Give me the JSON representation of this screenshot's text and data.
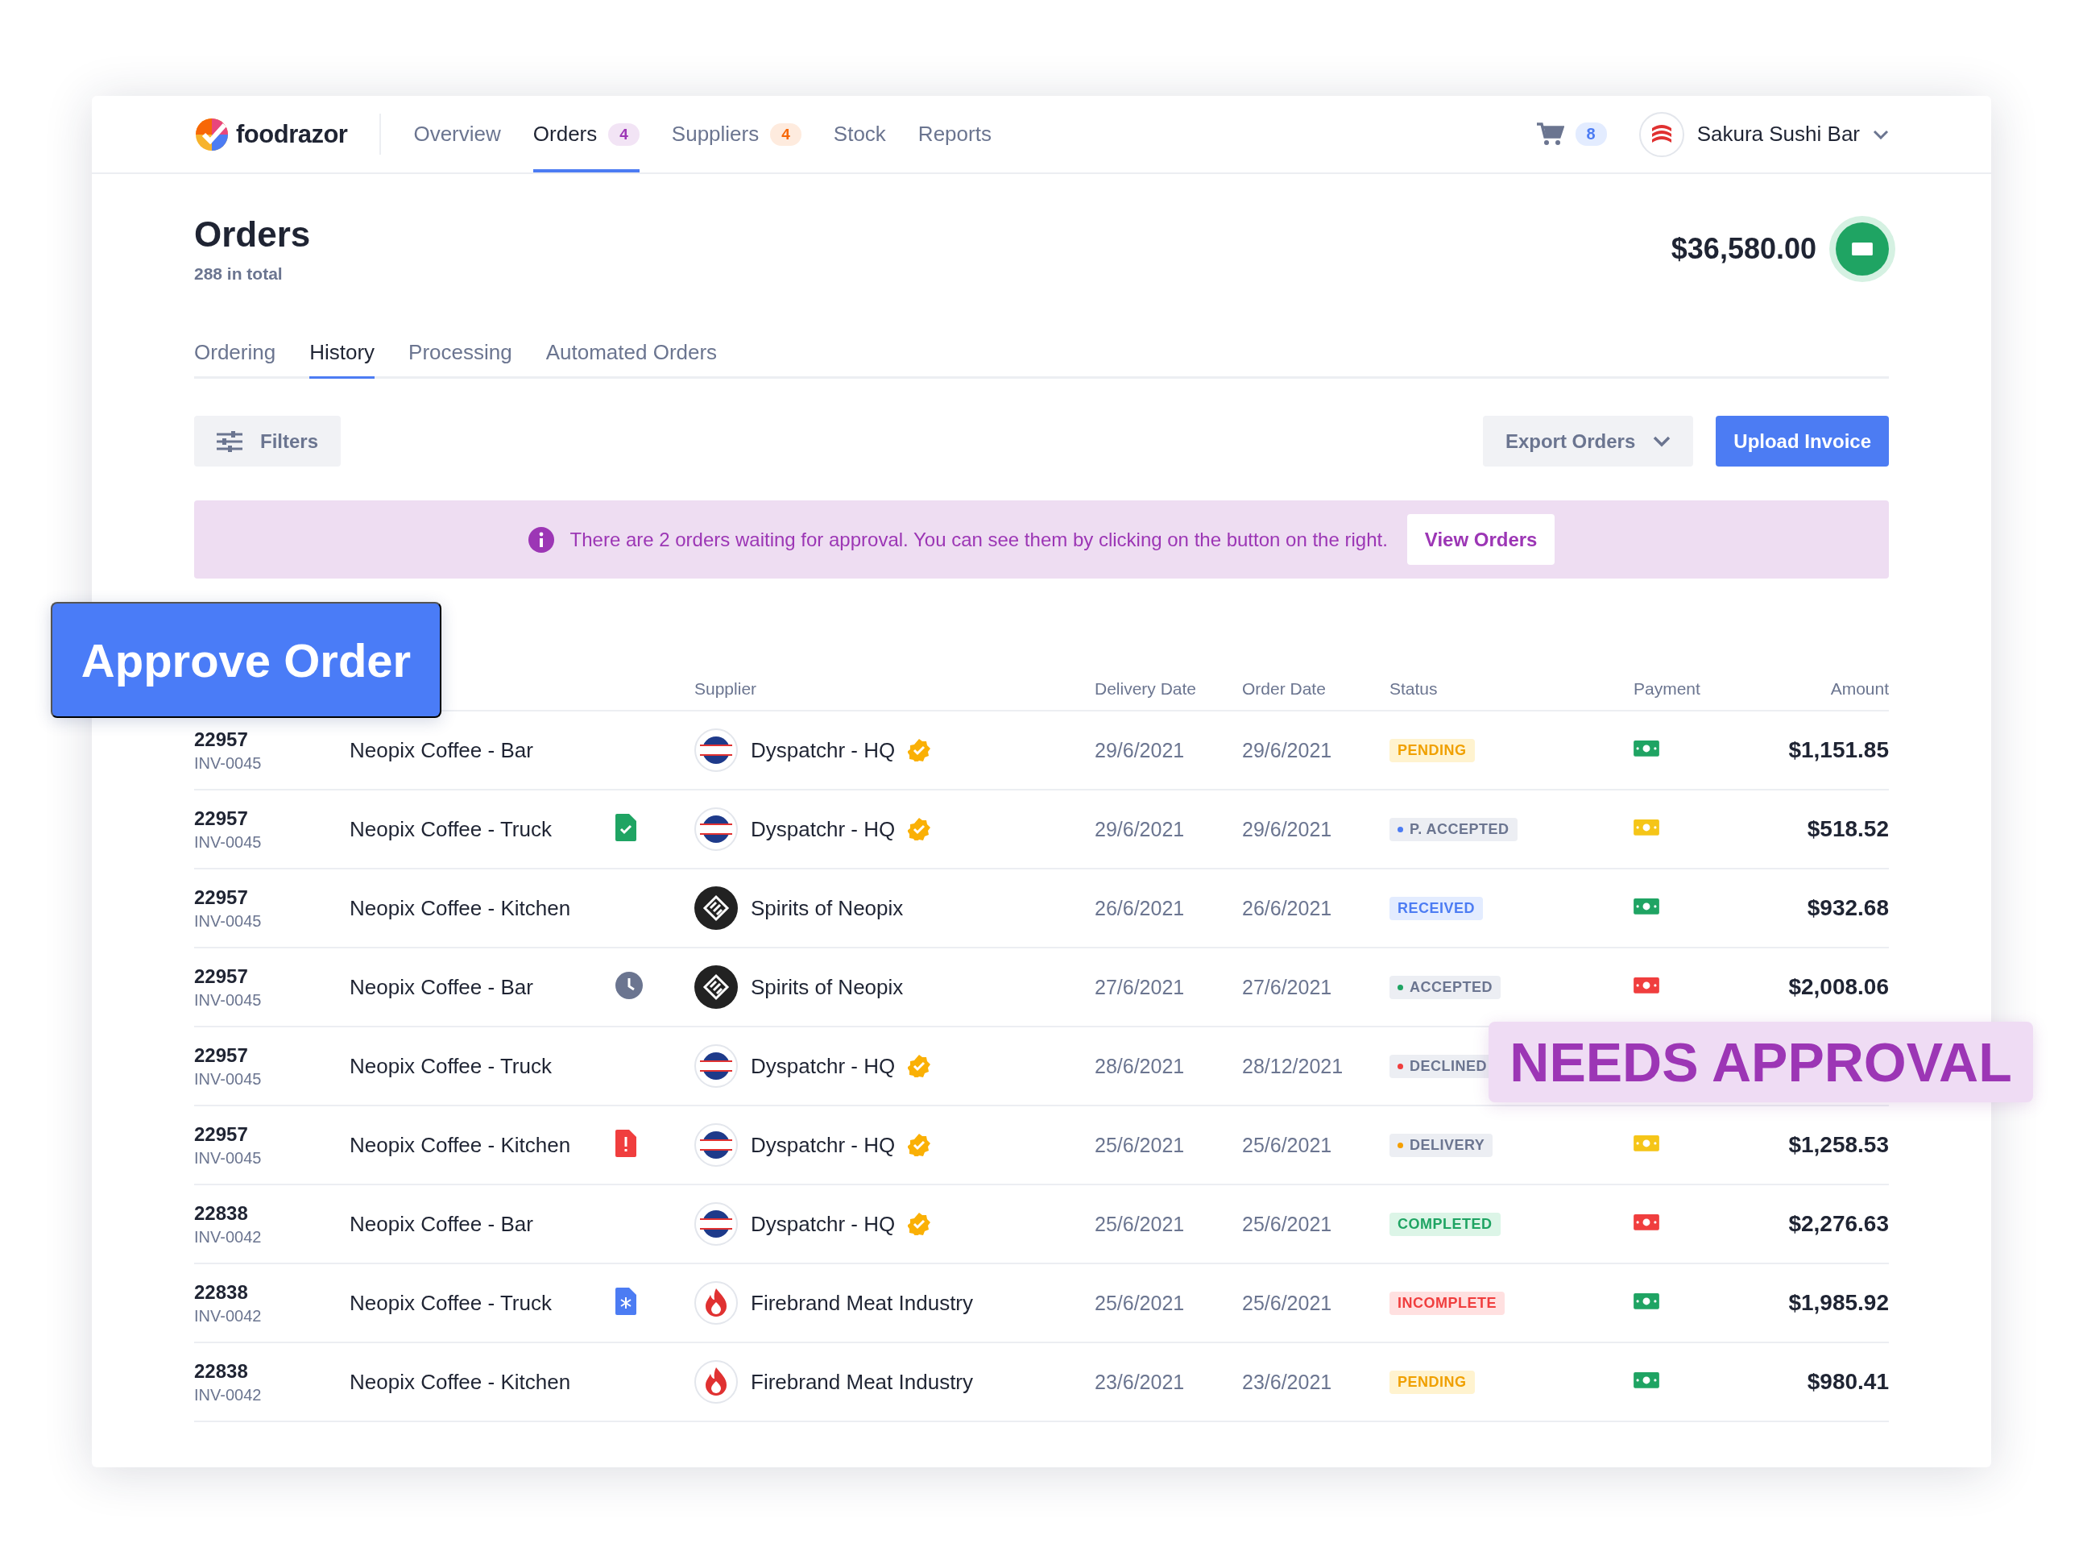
{
  "brand": {
    "name": "foodrazor"
  },
  "nav": [
    {
      "label": "Overview",
      "selected": false
    },
    {
      "label": "Orders",
      "badge": "4",
      "color": "#9c36b5",
      "selected": true
    },
    {
      "label": "Suppliers",
      "badge": "4",
      "color": "#f76707",
      "selected": false
    },
    {
      "label": "Stock",
      "selected": false
    },
    {
      "label": "Reports",
      "selected": false
    }
  ],
  "cart": {
    "count": "8"
  },
  "account": {
    "name": "Sakura Sushi Bar"
  },
  "page": {
    "title": "Orders",
    "subtitle": "288 in total",
    "total": "$36,580.00"
  },
  "tabs": [
    {
      "label": "Ordering",
      "selected": false
    },
    {
      "label": "History",
      "selected": true
    },
    {
      "label": "Processing",
      "selected": false
    },
    {
      "label": "Automated Orders",
      "selected": false
    }
  ],
  "toolbar": {
    "filters": "Filters",
    "export": "Export Orders",
    "upload": "Upload Invoice"
  },
  "banner": {
    "text": "There are 2 orders waiting for approval. You can see them by clicking on the button on the right.",
    "button": "View Orders"
  },
  "table": {
    "columns": [
      "Supplier",
      "Delivery Date",
      "Order Date",
      "Status",
      "Payment",
      "Amount"
    ],
    "rows": [
      {
        "id": "22957",
        "invoice": "INV-0045",
        "location": "Neopix Coffee - Bar",
        "supplier": {
          "name": "Dyspatchr - HQ",
          "kind": "dyspatchr",
          "verified": true
        },
        "delivery": "29/6/2021",
        "ordered": "29/6/2021",
        "status": {
          "label": "PENDING",
          "kind": "pending"
        },
        "payment": {
          "color": "#1fa463"
        },
        "amount": "$1,151.85"
      },
      {
        "id": "22957",
        "invoice": "INV-0045",
        "location": "Neopix Coffee - Truck",
        "flag": {
          "kind": "check-doc"
        },
        "supplier": {
          "name": "Dyspatchr - HQ",
          "kind": "dyspatchr",
          "verified": true
        },
        "delivery": "29/6/2021",
        "ordered": "29/6/2021",
        "status": {
          "label": "P. ACCEPTED",
          "kind": "dot-blue"
        },
        "payment": {
          "color": "#f5c518"
        },
        "amount": "$518.52"
      },
      {
        "id": "22957",
        "invoice": "INV-0045",
        "location": "Neopix Coffee - Kitchen",
        "supplier": {
          "name": "Spirits of Neopix",
          "kind": "spirits",
          "verified": false
        },
        "delivery": "26/6/2021",
        "ordered": "26/6/2021",
        "status": {
          "label": "RECEIVED",
          "kind": "received"
        },
        "payment": {
          "color": "#1fa463"
        },
        "amount": "$932.68"
      },
      {
        "id": "22957",
        "invoice": "INV-0045",
        "location": "Neopix Coffee - Bar",
        "flag": {
          "kind": "clock"
        },
        "supplier": {
          "name": "Spirits of Neopix",
          "kind": "spirits",
          "verified": false
        },
        "delivery": "27/6/2021",
        "ordered": "27/6/2021",
        "status": {
          "label": "ACCEPTED",
          "kind": "dot-green"
        },
        "payment": {
          "color": "#f03e3e"
        },
        "amount": "$2,008.06"
      },
      {
        "id": "22957",
        "invoice": "INV-0045",
        "location": "Neopix Coffee - Truck",
        "supplier": {
          "name": "Dyspatchr - HQ",
          "kind": "dyspatchr",
          "verified": true
        },
        "delivery": "28/6/2021",
        "ordered": "28/12/2021",
        "status": {
          "label": "DECLINED",
          "kind": "dot-red"
        }
      },
      {
        "id": "22957",
        "invoice": "INV-0045",
        "location": "Neopix Coffee - Kitchen",
        "flag": {
          "kind": "alert-doc"
        },
        "supplier": {
          "name": "Dyspatchr - HQ",
          "kind": "dyspatchr",
          "verified": true
        },
        "delivery": "25/6/2021",
        "ordered": "25/6/2021",
        "status": {
          "label": "DELIVERY",
          "kind": "dot-orange"
        },
        "payment": {
          "color": "#f5c518"
        },
        "amount": "$1,258.53"
      },
      {
        "id": "22838",
        "invoice": "INV-0042",
        "location": "Neopix Coffee - Bar",
        "supplier": {
          "name": "Dyspatchr - HQ",
          "kind": "dyspatchr",
          "verified": true
        },
        "delivery": "25/6/2021",
        "ordered": "25/6/2021",
        "status": {
          "label": "COMPLETED",
          "kind": "completed"
        },
        "payment": {
          "color": "#f03e3e"
        },
        "amount": "$2,276.63"
      },
      {
        "id": "22838",
        "invoice": "INV-0042",
        "location": "Neopix Coffee - Truck",
        "flag": {
          "kind": "snow-doc"
        },
        "supplier": {
          "name": "Firebrand Meat Industry",
          "kind": "firebrand",
          "verified": false
        },
        "delivery": "25/6/2021",
        "ordered": "25/6/2021",
        "status": {
          "label": "INCOMPLETE",
          "kind": "incomplete"
        },
        "payment": {
          "color": "#1fa463"
        },
        "amount": "$1,985.92"
      },
      {
        "id": "22838",
        "invoice": "INV-0042",
        "location": "Neopix Coffee - Kitchen",
        "supplier": {
          "name": "Firebrand Meat Industry",
          "kind": "firebrand",
          "verified": false
        },
        "delivery": "23/6/2021",
        "ordered": "23/6/2021",
        "status": {
          "label": "PENDING",
          "kind": "pending"
        },
        "payment": {
          "color": "#1fa463"
        },
        "amount": "$980.41"
      }
    ]
  },
  "callouts": [
    {
      "text": "Approve Order",
      "kind": "action"
    },
    {
      "text": "NEEDS APPROVAL",
      "kind": "tag"
    }
  ]
}
